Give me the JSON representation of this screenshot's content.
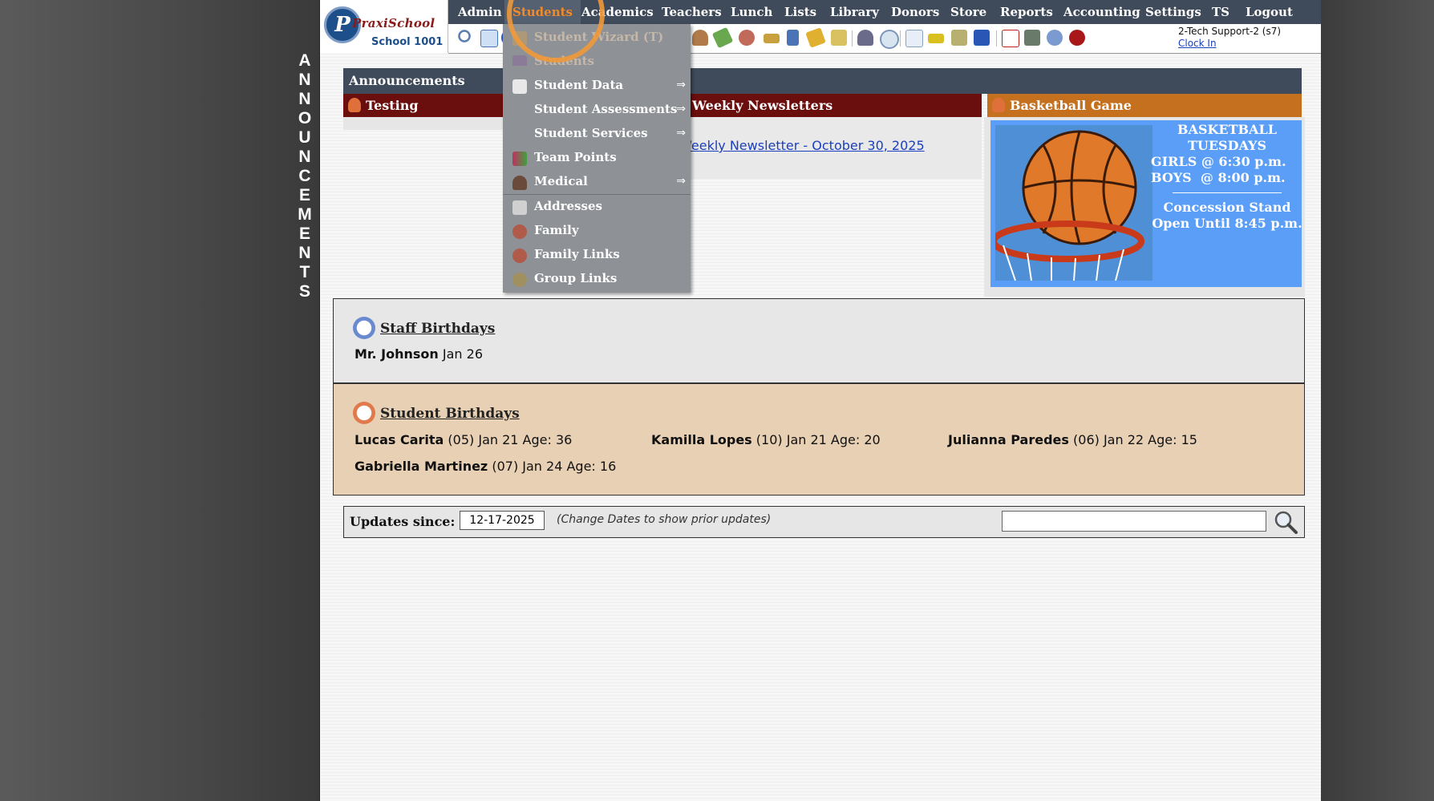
{
  "vertical_banner": "ANNOUNCEMENTS",
  "logo": {
    "brand": "PraxiSchool",
    "school": "School 1001"
  },
  "nav": [
    {
      "label": "Admin"
    },
    {
      "label": "Students"
    },
    {
      "label": "Academics"
    },
    {
      "label": "Teachers"
    },
    {
      "label": "Lunch"
    },
    {
      "label": "Lists"
    },
    {
      "label": "Library"
    },
    {
      "label": "Donors"
    },
    {
      "label": "Store"
    },
    {
      "label": "Reports"
    },
    {
      "label": "Accounting"
    },
    {
      "label": "Settings"
    },
    {
      "label": "TS"
    },
    {
      "label": "Logout"
    }
  ],
  "user": {
    "name": "2-Tech Support-2 (s7)",
    "clock_in": "Clock In"
  },
  "toolbar_icons": [
    "search-icon",
    "calendar-grid-icon",
    "info-icon",
    "staff-icon",
    "money-icon",
    "group-icon",
    "lunch-icon",
    "book-icon",
    "bell-icon",
    "forward-icon",
    "person-icon",
    "clock-icon",
    "table-icon",
    "card-icon",
    "print-icon",
    "ap-icon",
    "pdf-icon",
    "archive-icon",
    "help-icon",
    "power-icon"
  ],
  "announcements": {
    "title": "Announcements",
    "cards": [
      {
        "title": "Testing"
      },
      {
        "title": "Weekly Newsletters",
        "link": "Weekly Newsletter - October 30, 2025"
      },
      {
        "title": "Basketball Game",
        "lines": [
          "BASKETBALL",
          "TUESDAYS",
          "GIRLS @ 6:30 p.m.",
          "BOYS  @ 8:00 p.m.",
          "Concession Stand",
          "Open Until 8:45 p.m."
        ]
      }
    ]
  },
  "staff_birthdays": {
    "title": "Staff Birthdays",
    "entries": [
      {
        "name": "Mr. Johnson",
        "detail": "Jan 26"
      }
    ]
  },
  "student_birthdays": {
    "title": "Student Birthdays",
    "entries": [
      {
        "name": "Lucas Carita",
        "detail": "(05) Jan 21 Age: 36"
      },
      {
        "name": "Kamilla Lopes",
        "detail": "(10) Jan 21 Age: 20"
      },
      {
        "name": "Julianna Paredes",
        "detail": "(06) Jan 22 Age: 15"
      },
      {
        "name": "Gabriella Martinez",
        "detail": "(07) Jan 24 Age: 16"
      }
    ]
  },
  "updates": {
    "label": "Updates since:",
    "date": "12-17-2025",
    "hint": "(Change Dates to show prior updates)",
    "search_value": ""
  },
  "students_menu": {
    "items": [
      {
        "label": "Student Wizard (T)",
        "arrow": ""
      },
      {
        "label": "Students",
        "arrow": ""
      },
      {
        "label": "Student Data",
        "arrow": "⇒"
      },
      {
        "label": "Student Assessments",
        "arrow": "⇒"
      },
      {
        "label": "Student Services",
        "arrow": "⇒"
      },
      {
        "label": "Team Points",
        "arrow": ""
      },
      {
        "label": "Medical",
        "arrow": "⇒"
      },
      {
        "label": "Addresses",
        "arrow": ""
      },
      {
        "label": "Family",
        "arrow": ""
      },
      {
        "label": "Family Links",
        "arrow": ""
      },
      {
        "label": "Group Links",
        "arrow": ""
      }
    ]
  }
}
